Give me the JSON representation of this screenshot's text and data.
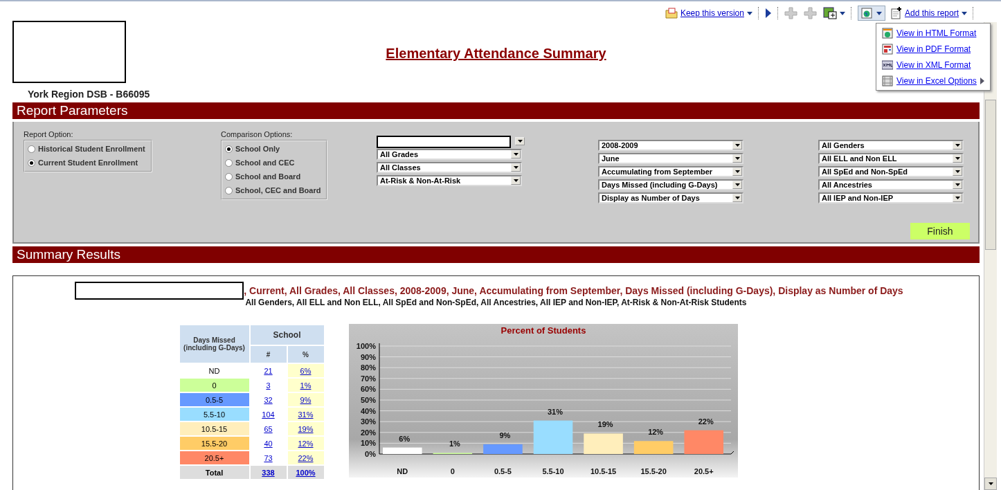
{
  "toolbar": {
    "keep_version": "Keep this version",
    "add_report": "Add this report"
  },
  "format_menu": {
    "items": [
      {
        "kind": "html",
        "label": "View in HTML Format",
        "submenu": false
      },
      {
        "kind": "pdf",
        "label": "View in PDF Format",
        "submenu": false
      },
      {
        "kind": "xml",
        "label": "View in XML Format",
        "submenu": false
      },
      {
        "kind": "excel",
        "label": "View in Excel Options",
        "submenu": true
      }
    ]
  },
  "header": {
    "title": "Elementary Attendance Summary",
    "org": "York Region DSB - B66095"
  },
  "report_parameters": {
    "heading": "Report Parameters",
    "report_option": {
      "label": "Report Option:",
      "options": [
        {
          "label": "Historical Student Enrollment",
          "selected": false
        },
        {
          "label": "Current Student Enrollment",
          "selected": true
        }
      ]
    },
    "comparison_options": {
      "label": "Comparison Options:",
      "options": [
        {
          "label": "School Only",
          "selected": true
        },
        {
          "label": "School and CEC",
          "selected": false
        },
        {
          "label": "School and Board",
          "selected": false
        },
        {
          "label": "School, CEC and Board",
          "selected": false
        }
      ]
    },
    "filter_columns": [
      [
        {
          "kind": "redacted"
        },
        {
          "kind": "select",
          "value": "All Grades"
        },
        {
          "kind": "select",
          "value": "All Classes"
        },
        {
          "kind": "select",
          "value": "At-Risk & Non-At-Risk"
        }
      ],
      [
        {
          "kind": "select",
          "value": "2008-2009"
        },
        {
          "kind": "select",
          "value": "June"
        },
        {
          "kind": "select",
          "value": "Accumulating from September"
        },
        {
          "kind": "select",
          "value": "Days Missed (including G-Days)"
        },
        {
          "kind": "select",
          "value": "Display as Number of Days"
        }
      ],
      [
        {
          "kind": "select",
          "value": "All Genders"
        },
        {
          "kind": "select",
          "value": "All ELL and Non ELL"
        },
        {
          "kind": "select",
          "value": "All SpEd and Non-SpEd"
        },
        {
          "kind": "select",
          "value": "All Ancestries"
        },
        {
          "kind": "select",
          "value": "All IEP and Non-IEP"
        }
      ]
    ],
    "finish": "Finish"
  },
  "summary_results": {
    "heading": "Summary Results",
    "criteria_line": ", Current, All Grades, All Classes, 2008-2009, June, Accumulating from September, Days Missed (including G-Days), Display as Number of Days",
    "filters_line": "All Genders, All ELL and Non ELL, All SpEd and Non-SpEd, All Ancestries, All IEP and Non-IEP, At-Risk & Non-At-Risk Students",
    "table": {
      "row_header": "Days Missed (including G-Days)",
      "group": "School",
      "columns": [
        "#",
        "%"
      ],
      "rows": [
        {
          "label": "ND",
          "count": "21",
          "percent": "6%",
          "color": "#ffffff"
        },
        {
          "label": "0",
          "count": "3",
          "percent": "1%",
          "color": "#ccff99"
        },
        {
          "label": "0.5-5",
          "count": "32",
          "percent": "9%",
          "color": "#6699ff"
        },
        {
          "label": "5.5-10",
          "count": "104",
          "percent": "31%",
          "color": "#99ddff"
        },
        {
          "label": "10.5-15",
          "count": "65",
          "percent": "19%",
          "color": "#ffeebb"
        },
        {
          "label": "15.5-20",
          "count": "40",
          "percent": "12%",
          "color": "#ffcc66"
        },
        {
          "label": "20.5+",
          "count": "73",
          "percent": "22%",
          "color": "#ff8866"
        }
      ],
      "total": {
        "label": "Total",
        "count": "338",
        "percent": "100%"
      }
    },
    "chart_data": {
      "type": "bar",
      "title": "Percent of Students",
      "categories": [
        "ND",
        "0",
        "0.5-5",
        "5.5-10",
        "10.5-15",
        "15.5-20",
        "20.5+"
      ],
      "series": [
        {
          "values": [
            6,
            1,
            9,
            31,
            19,
            12,
            22
          ]
        }
      ],
      "grid": true,
      "ylim": [
        0,
        100
      ],
      "yticks": [
        {
          "value": 0,
          "label": "0%"
        },
        {
          "value": 10,
          "label": "10%"
        },
        {
          "value": 20,
          "label": "20%"
        },
        {
          "value": 30,
          "label": "30%"
        },
        {
          "value": 40,
          "label": "40%"
        },
        {
          "value": 50,
          "label": "50%"
        },
        {
          "value": 60,
          "label": "60%"
        },
        {
          "value": 70,
          "label": "70%"
        },
        {
          "value": 80,
          "label": "80%"
        },
        {
          "value": 90,
          "label": "90%"
        },
        {
          "value": 100,
          "label": "100%"
        }
      ],
      "value_labels": [
        "6%",
        "1%",
        "9%",
        "31%",
        "19%",
        "12%",
        "22%"
      ]
    }
  }
}
